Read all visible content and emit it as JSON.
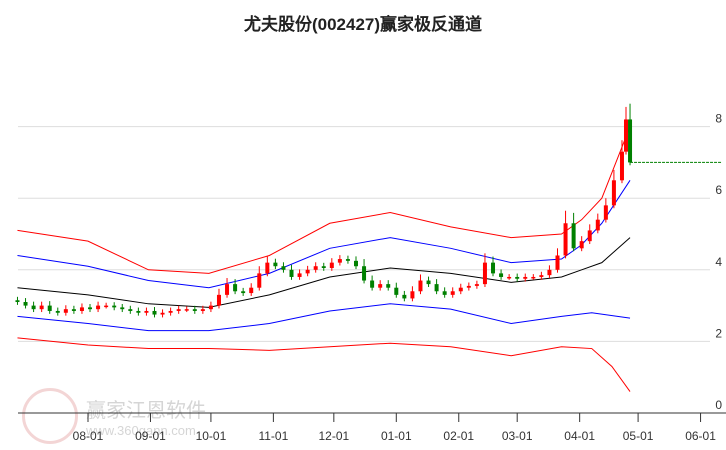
{
  "title": "尤夫股份(002427)赢家极反通道",
  "watermark": {
    "brand": "赢家江恩软件",
    "url": "www.360gann.com",
    "seal": "江赢恩家"
  },
  "chart_data": {
    "type": "candlestick",
    "title": "尤夫股份(002427)赢家极反通道",
    "x_unit": "days offset from 08-01",
    "ylim": [
      0,
      9
    ],
    "yticks": [
      {
        "v": 0,
        "label": "0"
      },
      {
        "v": 2,
        "label": "2"
      },
      {
        "v": 4,
        "label": "4"
      },
      {
        "v": 6,
        "label": "6"
      },
      {
        "v": 8,
        "label": "8"
      }
    ],
    "xticks": [
      {
        "d": 0,
        "label": "08-01"
      },
      {
        "d": 31,
        "label": "09-01"
      },
      {
        "d": 61,
        "label": "10-01"
      },
      {
        "d": 92,
        "label": "11-01"
      },
      {
        "d": 122,
        "label": "12-01"
      },
      {
        "d": 153,
        "label": "01-01"
      },
      {
        "d": 184,
        "label": "02-01"
      },
      {
        "d": 213,
        "label": "03-01"
      },
      {
        "d": 244,
        "label": "04-01"
      },
      {
        "d": 273,
        "label": "05-01"
      },
      {
        "d": 304,
        "label": "06-01"
      }
    ],
    "closes": [
      [
        -35,
        3.1
      ],
      [
        -31,
        3.0
      ],
      [
        -27,
        2.9
      ],
      [
        -23,
        3.0
      ],
      [
        -19,
        2.85
      ],
      [
        -15,
        2.8
      ],
      [
        -11,
        2.9
      ],
      [
        -7,
        2.85
      ],
      [
        -3,
        2.95
      ],
      [
        1,
        2.9
      ],
      [
        5,
        3.0
      ],
      [
        9,
        3.0
      ],
      [
        13,
        2.95
      ],
      [
        17,
        2.9
      ],
      [
        21,
        2.85
      ],
      [
        25,
        2.8
      ],
      [
        29,
        2.85
      ],
      [
        33,
        2.75
      ],
      [
        37,
        2.8
      ],
      [
        41,
        2.85
      ],
      [
        45,
        2.9
      ],
      [
        49,
        2.9
      ],
      [
        53,
        2.85
      ],
      [
        57,
        2.9
      ],
      [
        61,
        3.0
      ],
      [
        65,
        3.3
      ],
      [
        69,
        3.6
      ],
      [
        73,
        3.4
      ],
      [
        77,
        3.35
      ],
      [
        81,
        3.5
      ],
      [
        85,
        3.9
      ],
      [
        89,
        4.2
      ],
      [
        93,
        4.1
      ],
      [
        97,
        4.0
      ],
      [
        101,
        3.8
      ],
      [
        105,
        3.9
      ],
      [
        109,
        4.0
      ],
      [
        113,
        4.1
      ],
      [
        117,
        4.05
      ],
      [
        121,
        4.2
      ],
      [
        125,
        4.3
      ],
      [
        129,
        4.25
      ],
      [
        133,
        4.1
      ],
      [
        137,
        3.7
      ],
      [
        141,
        3.5
      ],
      [
        145,
        3.6
      ],
      [
        149,
        3.5
      ],
      [
        153,
        3.3
      ],
      [
        157,
        3.2
      ],
      [
        161,
        3.4
      ],
      [
        165,
        3.7
      ],
      [
        169,
        3.6
      ],
      [
        173,
        3.4
      ],
      [
        177,
        3.3
      ],
      [
        181,
        3.4
      ],
      [
        185,
        3.5
      ],
      [
        189,
        3.55
      ],
      [
        193,
        3.6
      ],
      [
        197,
        4.2
      ],
      [
        201,
        3.9
      ],
      [
        205,
        3.8
      ],
      [
        209,
        3.8
      ],
      [
        213,
        3.75
      ],
      [
        217,
        3.8
      ],
      [
        221,
        3.8
      ],
      [
        225,
        3.85
      ],
      [
        229,
        4.0
      ],
      [
        233,
        4.4
      ],
      [
        237,
        5.3
      ],
      [
        241,
        4.6
      ],
      [
        245,
        4.8
      ],
      [
        249,
        5.1
      ],
      [
        253,
        5.4
      ],
      [
        257,
        5.8
      ],
      [
        261,
        6.5
      ],
      [
        265,
        7.3
      ],
      [
        267,
        8.2
      ],
      [
        269,
        7.0
      ]
    ],
    "last_close_line": 7.0,
    "series": [
      {
        "name": "upper-red",
        "color": "#ff0000",
        "points": [
          [
            -35,
            5.1
          ],
          [
            0,
            4.8
          ],
          [
            30,
            4.0
          ],
          [
            60,
            3.9
          ],
          [
            90,
            4.4
          ],
          [
            120,
            5.3
          ],
          [
            150,
            5.6
          ],
          [
            180,
            5.2
          ],
          [
            210,
            4.9
          ],
          [
            235,
            5.0
          ],
          [
            245,
            5.4
          ],
          [
            255,
            6.0
          ],
          [
            269,
            8.0
          ]
        ]
      },
      {
        "name": "upper-blue",
        "color": "#0000ff",
        "points": [
          [
            -35,
            4.4
          ],
          [
            0,
            4.1
          ],
          [
            30,
            3.7
          ],
          [
            60,
            3.5
          ],
          [
            90,
            3.9
          ],
          [
            120,
            4.6
          ],
          [
            150,
            4.9
          ],
          [
            180,
            4.6
          ],
          [
            210,
            4.2
          ],
          [
            235,
            4.3
          ],
          [
            245,
            4.7
          ],
          [
            255,
            5.3
          ],
          [
            269,
            6.5
          ]
        ]
      },
      {
        "name": "middle-black",
        "color": "#000000",
        "points": [
          [
            -35,
            3.5
          ],
          [
            0,
            3.3
          ],
          [
            30,
            3.05
          ],
          [
            60,
            2.95
          ],
          [
            90,
            3.3
          ],
          [
            120,
            3.8
          ],
          [
            150,
            4.05
          ],
          [
            180,
            3.9
          ],
          [
            210,
            3.65
          ],
          [
            235,
            3.8
          ],
          [
            245,
            4.0
          ],
          [
            255,
            4.2
          ],
          [
            269,
            4.9
          ]
        ]
      },
      {
        "name": "lower-blue",
        "color": "#0000ff",
        "points": [
          [
            -35,
            2.7
          ],
          [
            0,
            2.5
          ],
          [
            30,
            2.3
          ],
          [
            60,
            2.3
          ],
          [
            90,
            2.5
          ],
          [
            120,
            2.85
          ],
          [
            150,
            3.05
          ],
          [
            180,
            2.9
          ],
          [
            210,
            2.5
          ],
          [
            235,
            2.7
          ],
          [
            250,
            2.8
          ],
          [
            269,
            2.65
          ]
        ]
      },
      {
        "name": "lower-red",
        "color": "#ff0000",
        "points": [
          [
            -35,
            2.1
          ],
          [
            0,
            1.9
          ],
          [
            30,
            1.8
          ],
          [
            60,
            1.8
          ],
          [
            90,
            1.75
          ],
          [
            120,
            1.85
          ],
          [
            150,
            1.95
          ],
          [
            180,
            1.85
          ],
          [
            210,
            1.6
          ],
          [
            235,
            1.85
          ],
          [
            250,
            1.8
          ],
          [
            260,
            1.3
          ],
          [
            269,
            0.6
          ]
        ]
      }
    ]
  }
}
